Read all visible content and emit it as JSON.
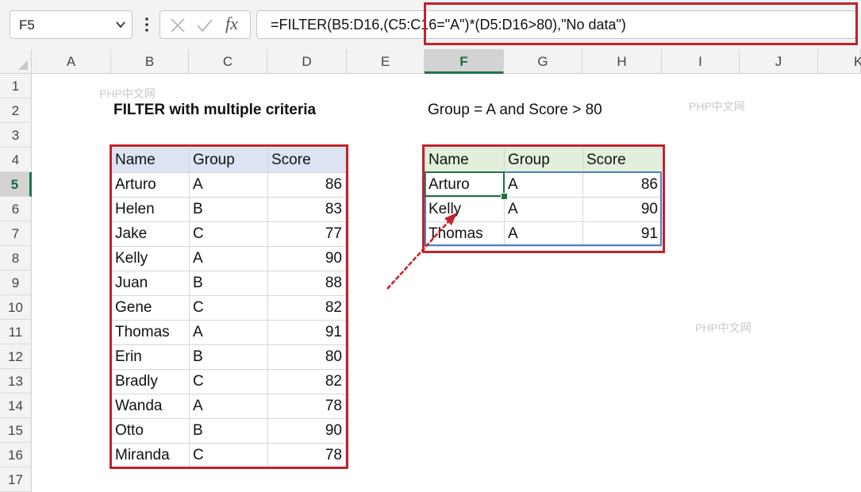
{
  "formula_bar": {
    "name_box": "F5",
    "formula": "=FILTER(B5:D16,(C5:C16=\"A\")*(D5:D16>80),\"No data\")"
  },
  "columns": [
    "A",
    "B",
    "C",
    "D",
    "E",
    "F",
    "G",
    "H",
    "I",
    "J",
    "K"
  ],
  "selected_column": "F",
  "rows": [
    "1",
    "2",
    "3",
    "4",
    "5",
    "6",
    "7",
    "8",
    "9",
    "10",
    "11",
    "12",
    "13",
    "14",
    "15",
    "16",
    "17"
  ],
  "selected_row": "5",
  "sheet": {
    "title": "FILTER with multiple criteria",
    "criteria": "Group = A and Score > 80"
  },
  "source_table": {
    "headers": [
      "Name",
      "Group",
      "Score"
    ],
    "rows": [
      {
        "name": "Arturo",
        "group": "A",
        "score": "86"
      },
      {
        "name": "Helen",
        "group": "B",
        "score": "83"
      },
      {
        "name": "Jake",
        "group": "C",
        "score": "77"
      },
      {
        "name": "Kelly",
        "group": "A",
        "score": "90"
      },
      {
        "name": "Juan",
        "group": "B",
        "score": "88"
      },
      {
        "name": "Gene",
        "group": "C",
        "score": "82"
      },
      {
        "name": "Thomas",
        "group": "A",
        "score": "91"
      },
      {
        "name": "Erin",
        "group": "B",
        "score": "80"
      },
      {
        "name": "Bradly",
        "group": "C",
        "score": "82"
      },
      {
        "name": "Wanda",
        "group": "A",
        "score": "78"
      },
      {
        "name": "Otto",
        "group": "B",
        "score": "90"
      },
      {
        "name": "Miranda",
        "group": "C",
        "score": "78"
      }
    ]
  },
  "result_table": {
    "headers": [
      "Name",
      "Group",
      "Score"
    ],
    "rows": [
      {
        "name": "Arturo",
        "group": "A",
        "score": "86"
      },
      {
        "name": "Kelly",
        "group": "A",
        "score": "90"
      },
      {
        "name": "Thomas",
        "group": "A",
        "score": "91"
      }
    ]
  },
  "watermarks": [
    "PHP中文网",
    "PHP中文网",
    "PHP中文网"
  ],
  "colors": {
    "accent_green": "#217346",
    "highlight_red": "#c0232c",
    "source_header": "#dce3f3",
    "result_header": "#e2efda"
  }
}
